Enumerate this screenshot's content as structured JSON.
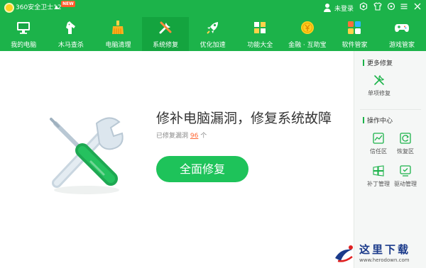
{
  "app": {
    "title": "360安全卫士12",
    "new_badge": "NEW",
    "user_label": "未登录"
  },
  "nav": {
    "items": [
      {
        "label": "我的电脑",
        "icon": "monitor-icon"
      },
      {
        "label": "木马查杀",
        "icon": "horse-icon"
      },
      {
        "label": "电脑清理",
        "icon": "broom-icon"
      },
      {
        "label": "系统修复",
        "icon": "wrench-icon",
        "active": true
      },
      {
        "label": "优化加速",
        "icon": "rocket-icon"
      },
      {
        "label": "功能大全",
        "icon": "grid-icon"
      },
      {
        "label": "金融 · 互助宝",
        "icon": "coin-icon"
      },
      {
        "label": "软件管家",
        "icon": "apps-icon"
      },
      {
        "label": "游戏管家",
        "icon": "gamepad-icon"
      }
    ]
  },
  "main": {
    "headline": "修补电脑漏洞，修复系统故障",
    "sub_prefix": "已修复漏洞",
    "fixed_count": "96",
    "sub_suffix": "个",
    "fix_button": "全面修复"
  },
  "sidebar": {
    "section_more": "更多修复",
    "single_fix": "单项修复",
    "section_ops": "操作中心",
    "trust_zone": "信任区",
    "restore_zone": "恢复区",
    "patch_mgmt": "补丁管理",
    "driver_mgmt": "驱动管理"
  },
  "watermark": {
    "text": "这里下载",
    "url": "www.herodown.com"
  },
  "colors": {
    "brand_green": "#1cb34a",
    "button_green": "#1ec35a",
    "count_orange": "#ff6633"
  }
}
